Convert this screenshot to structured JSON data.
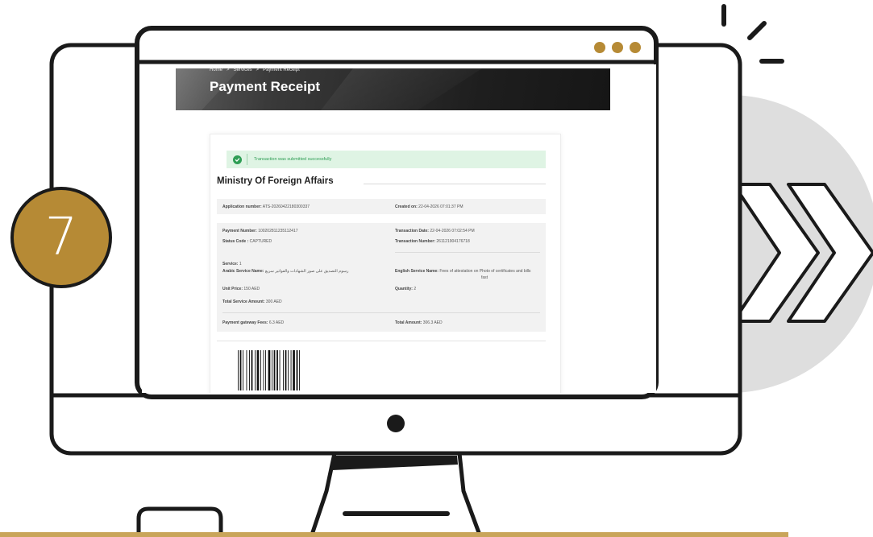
{
  "step": {
    "number": "7"
  },
  "colors": {
    "accent": "#b68a35",
    "outline": "#1a1a1a",
    "success": "#2f9e55",
    "success_bg": "#dff4e4"
  },
  "breadcrumb": {
    "items": [
      "Home",
      "Services",
      "Payment Receipt"
    ],
    "separator": ">"
  },
  "page": {
    "title": "Payment Receipt"
  },
  "alert": {
    "message": "Transaction was submitted successfully",
    "icon": "check-circle-icon"
  },
  "receipt": {
    "organization": "Ministry Of Foreign Affairs",
    "application_label": "Application number:",
    "application_value": "ATS-20260422180300337",
    "created_label": "Created on:",
    "created_value": "22-04-2026 07:01:37 PM",
    "payment_number_label": "Payment Number:",
    "payment_number_value": "100202811235112417",
    "transaction_date_label": "Transaction Date:",
    "transaction_date_value": "22-04-2026 07:02:54 PM",
    "status_label": "Status Code :",
    "status_value": "CAPTURED",
    "transaction_number_label": "Transaction Number:",
    "transaction_number_value": "261121904176718",
    "service_label": "Service:",
    "service_value": "1",
    "arabic_service_label": "Arabic Service Name:",
    "arabic_service_value": "رسوم التصديق على صور الشهادات والفواتير سريع",
    "english_service_label": "English Service Name:",
    "english_service_value": "Fees of attestation on Photo of certificates and bills",
    "english_service_value_2": "fast",
    "unit_price_label": "Unit Price:",
    "unit_price_value": "150 AED",
    "quantity_label": "Quantity:",
    "quantity_value": "2",
    "total_service_label": "Total Service Amount:",
    "total_service_value": "300 AED",
    "gateway_fees_label": "Payment gateway Fees:",
    "gateway_fees_value": "6.3 AED",
    "total_amount_label": "Total Amount:",
    "total_amount_value": "306.3 AED"
  }
}
